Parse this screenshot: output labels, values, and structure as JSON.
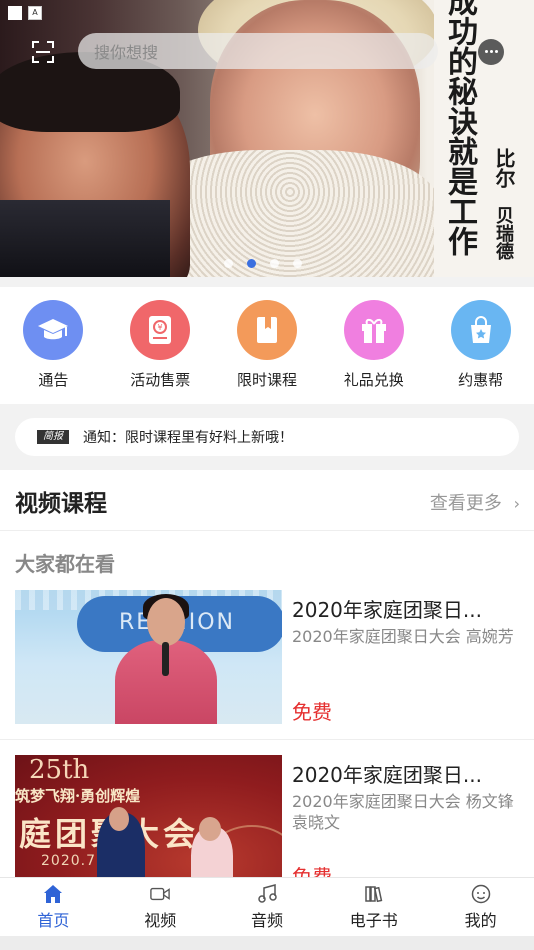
{
  "banner": {
    "calligraphy_main": "成功的秘诀就是工作",
    "calligraphy_author": [
      "比尔",
      "贝瑞德"
    ],
    "slides": 4,
    "active_slide": 1
  },
  "search": {
    "placeholder": "搜你想搜"
  },
  "status_bar": {
    "left_glyph": "A"
  },
  "grid": [
    {
      "label": "通告",
      "color": "#6e8ff2",
      "icon": "graduation-cap-icon"
    },
    {
      "label": "活动售票",
      "color": "#f0676a",
      "icon": "ticket-icon"
    },
    {
      "label": "限时课程",
      "color": "#f39a5a",
      "icon": "book-icon"
    },
    {
      "label": "礼品兑换",
      "color": "#f07fe0",
      "icon": "gift-icon"
    },
    {
      "label": "约惠帮",
      "color": "#69b6f2",
      "icon": "shopping-bag-icon"
    }
  ],
  "notice": {
    "badge": "简报",
    "text": "通知：限时课程里有好料上新哦！"
  },
  "video_section": {
    "title": "视频课程",
    "more": "查看更多",
    "subtitle": "大家都在看"
  },
  "courses": [
    {
      "title": "2020年家庭团聚日...",
      "desc": "2020年家庭团聚日大会 高婉芳",
      "price": "免费",
      "thumb_text": "REUNION"
    },
    {
      "title": "2020年家庭团聚日...",
      "desc": "2020年家庭团聚日大会 杨文锋 袁晓文",
      "price": "免费",
      "thumb_big": "25th",
      "thumb_slogan": "筑梦飞翔·勇创辉煌",
      "thumb_title": "庭团聚大会",
      "thumb_year": "2020.7"
    }
  ],
  "tabs": [
    {
      "label": "首页",
      "icon": "home-icon",
      "active": true
    },
    {
      "label": "视频",
      "icon": "video-icon",
      "active": false
    },
    {
      "label": "音频",
      "icon": "music-icon",
      "active": false
    },
    {
      "label": "电子书",
      "icon": "books-icon",
      "active": false
    },
    {
      "label": "我的",
      "icon": "profile-icon",
      "active": false
    }
  ],
  "colors": {
    "accent": "#2f63d6",
    "price": "#e53030"
  }
}
